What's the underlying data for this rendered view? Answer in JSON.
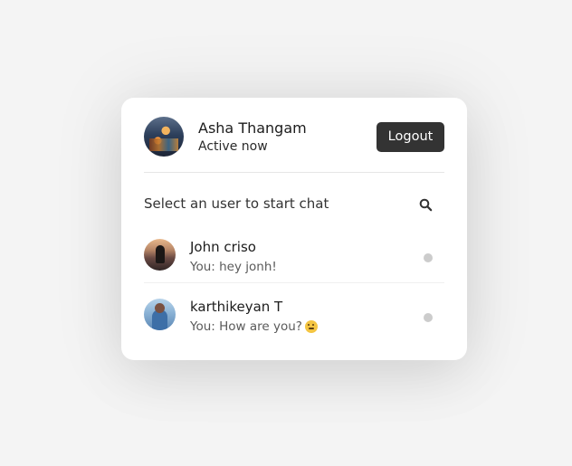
{
  "header": {
    "user_name": "Asha Thangam",
    "status": "Active now",
    "logout_label": "Logout"
  },
  "search": {
    "prompt": "Select an user to start chat",
    "icon": "search-icon"
  },
  "users": [
    {
      "name": "John criso",
      "last_message": "You: hey jonh!",
      "online": false,
      "status_color": "#cccccc"
    },
    {
      "name": "karthikeyan T",
      "last_message": "You: How are you?",
      "emoji": "slightly-smiling-face",
      "online": false,
      "status_color": "#cccccc"
    }
  ],
  "colors": {
    "background": "#f4f4f4",
    "card": "#ffffff",
    "button": "#333333",
    "offline_dot": "#cccccc"
  }
}
